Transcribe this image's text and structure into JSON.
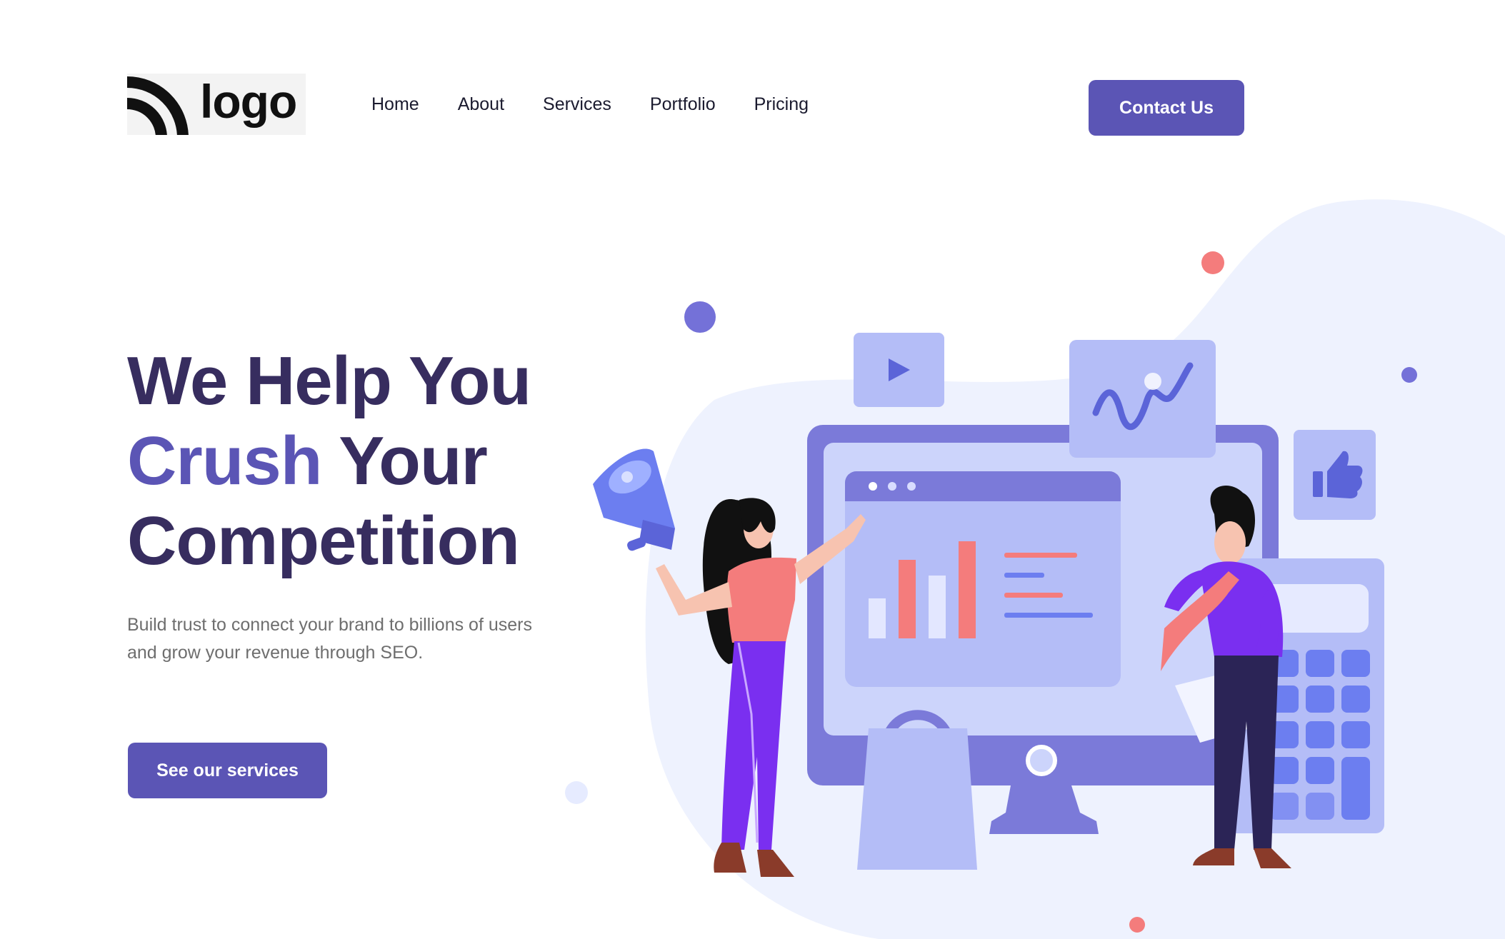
{
  "logo": {
    "text": "logo"
  },
  "nav": {
    "items": [
      {
        "label": "Home"
      },
      {
        "label": "About"
      },
      {
        "label": "Services"
      },
      {
        "label": "Portfolio"
      },
      {
        "label": "Pricing"
      }
    ],
    "contact_label": "Contact Us"
  },
  "hero": {
    "headline_line1": "We Help You",
    "headline_highlight": "Crush",
    "headline_line2_rest": " Your",
    "headline_line3": "Competition",
    "subtitle": "Build trust to connect your brand to billions of users and grow your revenue through SEO.",
    "cta_label": "See our services"
  },
  "colors": {
    "primary": "#5b55b5",
    "headline": "#372d5f",
    "accent_coral": "#f47c7c",
    "illustration_lavender": "#b4bdf7",
    "blob": "#eef2fe"
  },
  "illustration": {
    "icons": [
      "play-icon",
      "wave-chart-icon",
      "thumbs-up-icon",
      "megaphone-icon",
      "shopping-bag-icon",
      "calculator-icon",
      "bar-chart-icon"
    ]
  }
}
